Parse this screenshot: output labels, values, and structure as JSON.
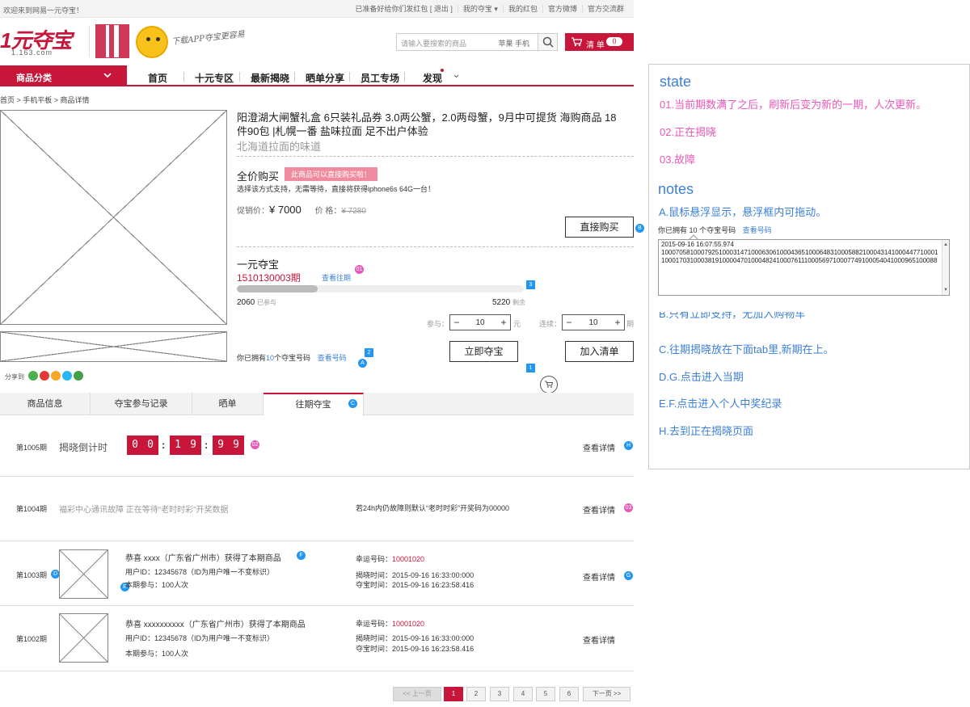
{
  "topbar": {
    "welcome": "欢迎来到网易一元夺宝！",
    "notice": "已准备好给你们发红包 [ 退出 ]",
    "my_duobao": "我的夺宝 ▾",
    "my_redpacket": "我的红包",
    "weibo": "官方微博",
    "qq_group": "官方交流群"
  },
  "header": {
    "logo": "1元夺宝",
    "logo_sub": "1.163.com",
    "app_text": "下载APP夺宝更容易",
    "search_placeholder": "请输入要搜索的商品",
    "search_keywords": "苹果  手机",
    "cart_label": "清 单",
    "cart_count": "0"
  },
  "nav": {
    "category": "商品分类",
    "items": [
      "首页",
      "十元专区",
      "最新揭晓",
      "晒单分享",
      "员工专场",
      "发现"
    ]
  },
  "breadcrumb": "首页 > 手机平板 > 商品详情",
  "product": {
    "title": "阳澄湖大闸蟹礼盒 6只装礼品券 3.0两公蟹，2.0两母蟹，9月中可提货  海购商品 18件90包 |札幌一番 盐味拉面 足不出户体验",
    "subtitle": "北海道拉面的味道",
    "fullbuy_label": "全价购买",
    "fullbuy_tag": "此商品可以直接购买啦！",
    "fullbuy_desc": "选择该方式支持，无需等待，直接将获得iphone6s 64G一台！",
    "promo_label": "促销价：",
    "promo_price": "¥ 7000",
    "price_label": "价  格：",
    "price_orig": "¥ 7280",
    "buy_now": "直接购买",
    "yiyuan_label": "一元夺宝",
    "period": "1510130003期",
    "view_past": "查看往期",
    "joined": "2060",
    "joined_label": "已参与",
    "remaining": "5220",
    "remaining_label": "剩余",
    "progress": 0.283,
    "join_label": "参与：",
    "join_qty": "10",
    "join_unit": "元",
    "cont_label": "连续：",
    "cont_qty": "10",
    "cont_unit": "期",
    "own_prefix": "你已拥有",
    "own_count": "10",
    "own_suffix": "个夺宝号码",
    "view_codes": "查看号码",
    "duobao_now": "立即夺宝",
    "add_list": "加入清单",
    "share_label": "分享到"
  },
  "markers": {
    "B": "B",
    "A": "A",
    "C": "C",
    "D": "D",
    "E": "E",
    "F": "F",
    "G": "G",
    "H": "H",
    "s1": "1",
    "s2": "2",
    "s3": "3",
    "m01": "01",
    "m02": "02",
    "m03": "03"
  },
  "tabs": [
    "商品信息",
    "夺宝参与记录",
    "晒单",
    "往期夺宝"
  ],
  "rows": {
    "r1005": {
      "period": "第1005期",
      "label": "揭晓倒计时",
      "digits": [
        "0",
        "0",
        "1",
        "9",
        "9",
        "9"
      ],
      "detail": "查看详情"
    },
    "r1004": {
      "period": "第1004期",
      "msg": "福彩中心通讯故障  正在等待“老时时彩”开奖数据",
      "note": "若24h内仍故障则默认“老时时彩”开奖码为00000",
      "detail": "查看详情"
    },
    "r1003": {
      "period": "第1003期",
      "winner": "恭喜 xxxx（广东省广州市）获得了本期商品",
      "uid": "用户ID：12345678（ID为用户唯一不变标识）",
      "join": "本期参与：100人次",
      "lucky_label": "幸运号码：",
      "lucky": "10001020",
      "reveal": "揭晓时间：2015-09-16  16:33:00:000",
      "duobao": "夺宝时间：2015-09-16  16:23:58.416",
      "detail": "查看详情"
    },
    "r1002": {
      "period": "第1002期",
      "winner": "恭喜 xxxxxxxxxx（广东省广州市）获得了本期商品",
      "uid": "用户ID：12345678（ID为用户唯一不变标识）",
      "join": "本期参与：100人次",
      "lucky_label": "幸运号码：",
      "lucky": "10001020",
      "reveal": "揭晓时间：2015-09-16  16:33:00:000",
      "duobao": "夺宝时间：2015-09-16  16:23:58.416",
      "detail": "查看详情"
    }
  },
  "pagination": {
    "prev": "<< 上一页",
    "pages": [
      "1",
      "2",
      "3",
      "4",
      "5",
      "6"
    ],
    "next": "下一页 >>"
  },
  "notes": {
    "state_title": "state",
    "s01": "01.当前期数满了之后，刷新后变为新的一期，人次更新。",
    "s02": "02.正在揭晓",
    "s03": "03.故障",
    "notes_title": "notes",
    "a": "A.鼠标悬浮显示，悬浮框内可拖动。",
    "popup_prefix": "你已拥有",
    "popup_count": "10",
    "popup_suffix": "个夺宝号码",
    "popup_link": "查看号码",
    "popup_time": "2015-09-16 16:07:55.974",
    "popup_line1": "10007058100079251000314710006306100043651000648310005882100043141000447710001",
    "popup_line2": "10001703100038191000047010004824100076111000569710007749100054041000965100088",
    "b": "B.只有立即支持，无加入购物车",
    "c": "C.往期揭晓放在下面tab里,新期在上。",
    "d": "D.G.点击进入当期",
    "e": "E.F.点击进入个人中奖纪录",
    "h": "H.去到正在揭晓页面"
  },
  "colors": {
    "accent": "#c8163a",
    "note_blue": "#3b7fd6",
    "note_pink": "#e858b8",
    "marker_blue": "#2196f3"
  }
}
